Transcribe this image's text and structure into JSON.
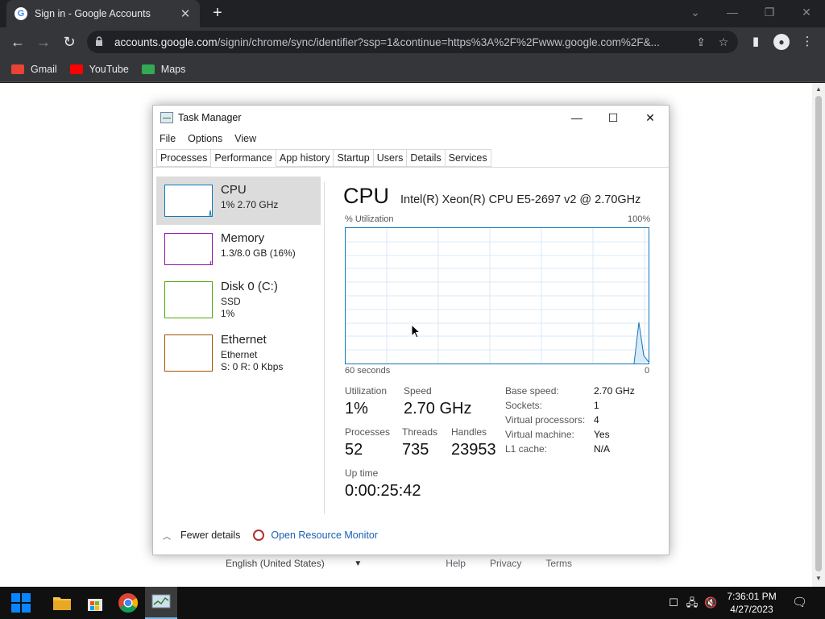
{
  "browser": {
    "tab_title": "Sign in - Google Accounts",
    "url_host": "accounts.google.com",
    "url_path": "/signin/chrome/sync/identifier?ssp=1&continue=https%3A%2F%2Fwww.google.com%2F&...",
    "bookmarks": [
      {
        "label": "Gmail",
        "icon": "gmail-icon",
        "color": "#ea4335"
      },
      {
        "label": "YouTube",
        "icon": "youtube-icon",
        "color": "#ff0000"
      },
      {
        "label": "Maps",
        "icon": "maps-icon",
        "color": "#34a853"
      }
    ]
  },
  "page_footer": {
    "language": "English (United States)",
    "links": [
      "Help",
      "Privacy",
      "Terms"
    ]
  },
  "task_manager": {
    "title": "Task Manager",
    "menu": [
      "File",
      "Options",
      "View"
    ],
    "tabs": [
      "Processes",
      "Performance",
      "App history",
      "Startup",
      "Users",
      "Details",
      "Services"
    ],
    "active_tab": "Performance",
    "resources": [
      {
        "name": "CPU",
        "sub1": "1% 2.70 GHz",
        "sub2": "",
        "color": "#1177bb"
      },
      {
        "name": "Memory",
        "sub1": "1.3/8.0 GB (16%)",
        "sub2": "",
        "color": "#8b12ae"
      },
      {
        "name": "Disk 0 (C:)",
        "sub1": "SSD",
        "sub2": "1%",
        "color": "#4da60c"
      },
      {
        "name": "Ethernet",
        "sub1": "Ethernet",
        "sub2": "S: 0 R: 0 Kbps",
        "color": "#a74f01"
      }
    ],
    "cpu": {
      "heading": "CPU",
      "model": "Intel(R) Xeon(R) CPU E5-2697 v2 @ 2.70GHz",
      "util_label": "% Utilization",
      "util_max": "100%",
      "graph_left": "60 seconds",
      "graph_right": "0",
      "stats": {
        "utilization_label": "Utilization",
        "utilization": "1%",
        "speed_label": "Speed",
        "speed": "2.70 GHz",
        "processes_label": "Processes",
        "processes": "52",
        "threads_label": "Threads",
        "threads": "735",
        "handles_label": "Handles",
        "handles": "23953",
        "uptime_label": "Up time",
        "uptime": "0:00:25:42"
      },
      "details": [
        {
          "k": "Base speed:",
          "v": "2.70 GHz"
        },
        {
          "k": "Sockets:",
          "v": "1"
        },
        {
          "k": "Virtual processors:",
          "v": "4"
        },
        {
          "k": "Virtual machine:",
          "v": "Yes"
        },
        {
          "k": "L1 cache:",
          "v": "N/A"
        }
      ]
    },
    "footer": {
      "fewer_details": "Fewer details",
      "open_resource_monitor": "Open Resource Monitor"
    }
  },
  "taskbar": {
    "time": "7:36:01 PM",
    "date": "4/27/2023"
  },
  "colors": {
    "chrome_dark": "#202124",
    "chrome_toolbar": "#35363a",
    "cpu_blue": "#1177bb",
    "link_blue": "#1a5fb4"
  }
}
